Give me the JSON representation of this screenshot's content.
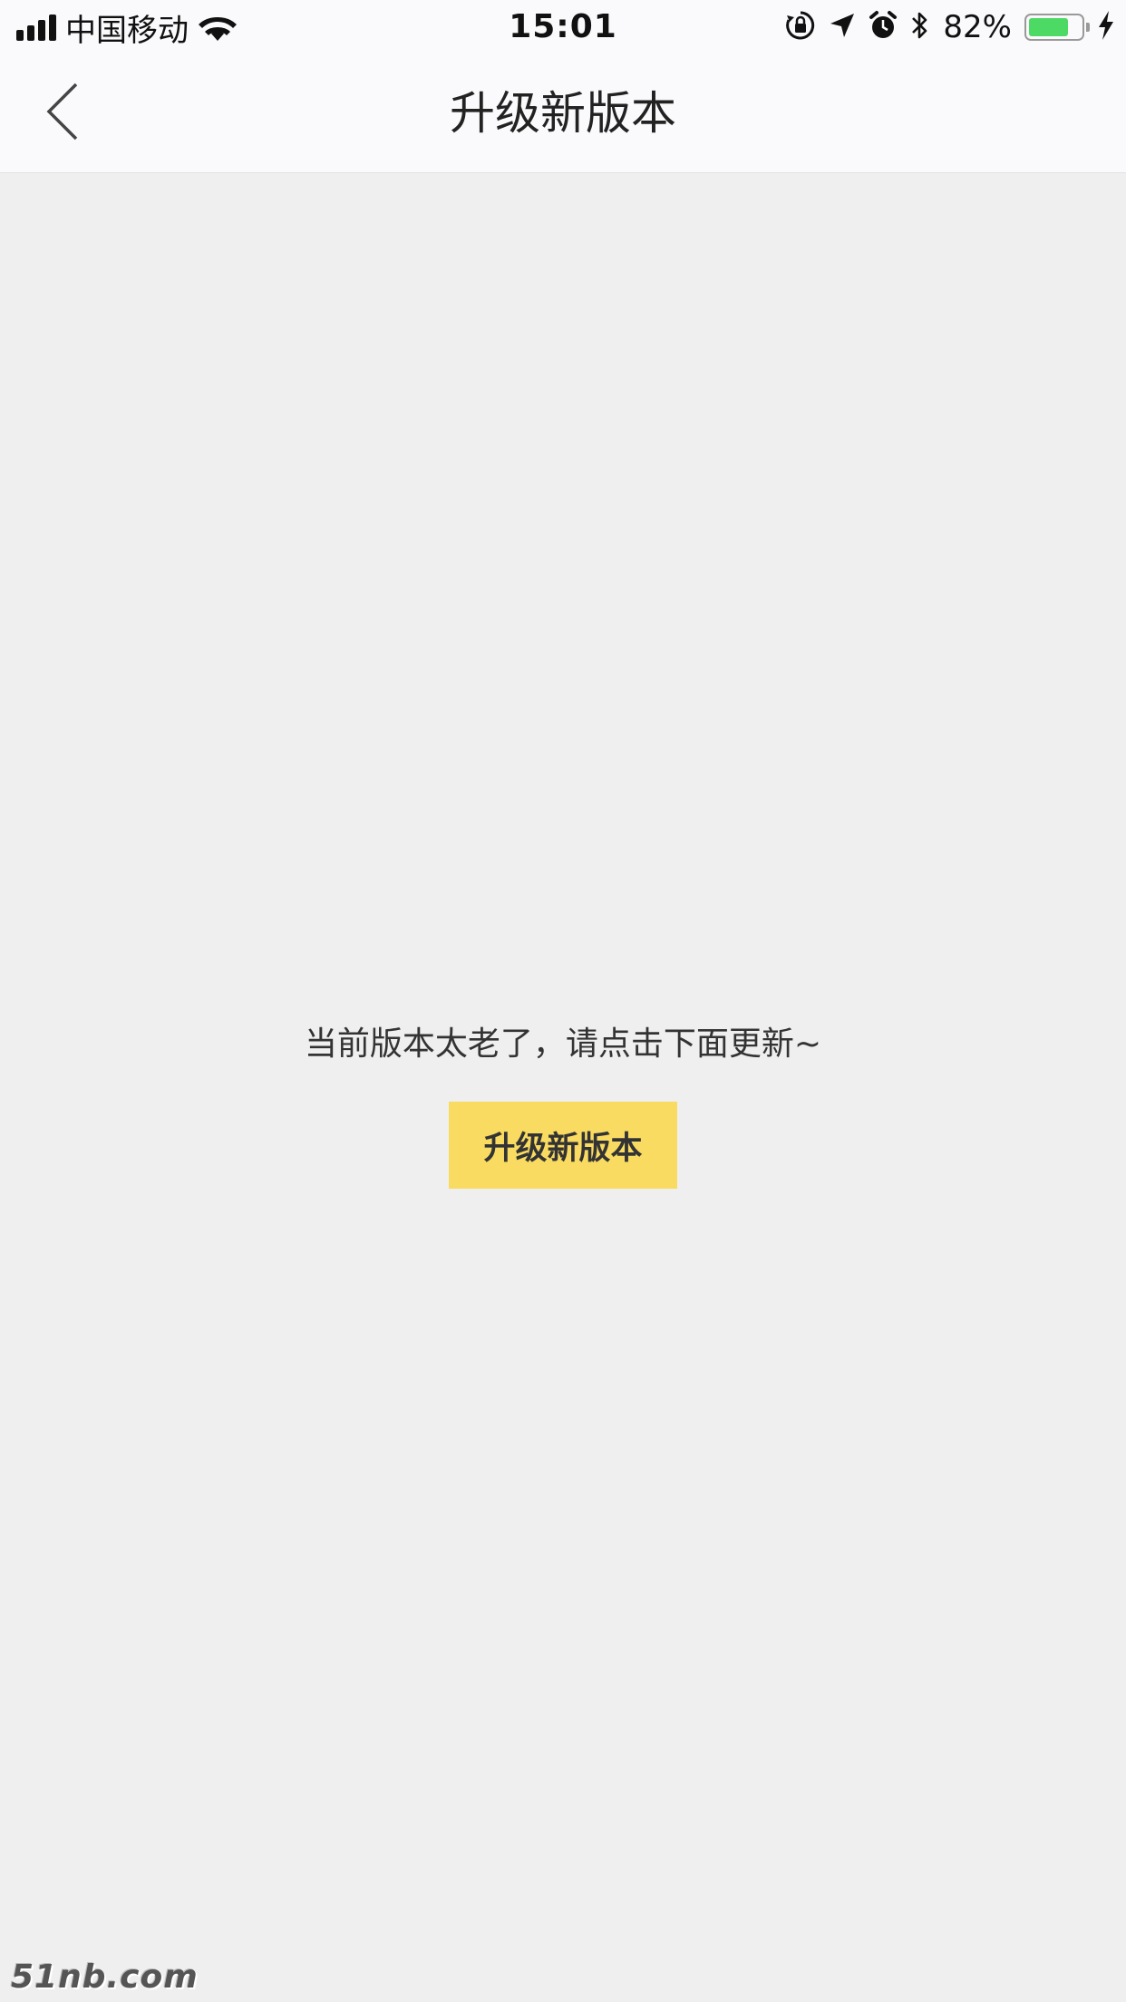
{
  "status_bar": {
    "carrier": "中国移动",
    "time": "15:01",
    "battery_percent_label": "82%",
    "battery_level": 0.82,
    "icons": [
      "signal-icon",
      "wifi-icon",
      "orientation-lock-icon",
      "location-arrow-icon",
      "alarm-icon",
      "bluetooth-icon",
      "battery-icon",
      "charging-bolt-icon"
    ],
    "battery_color": "#4cd964"
  },
  "nav": {
    "title": "升级新版本",
    "back_icon": "chevron-left-icon"
  },
  "main": {
    "message": "当前版本太老了，请点击下面更新~",
    "upgrade_button_label": "升级新版本",
    "button_color": "#f9db62",
    "background_color": "#efefef"
  },
  "watermark": {
    "text": "51nb.com"
  }
}
